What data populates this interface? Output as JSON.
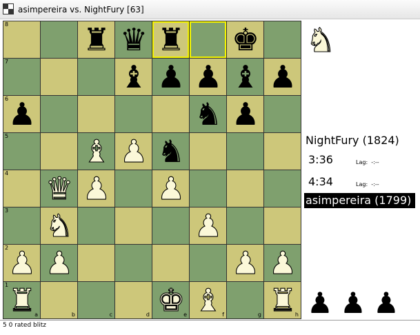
{
  "window": {
    "title": "asimpereira vs. NightFury [63]",
    "icon": "freechess-app-icon"
  },
  "colors": {
    "light_square": "#cdc77a",
    "dark_square": "#7fa06e",
    "highlight": "#f4f400",
    "white_piece": "#fbf8d8",
    "black_piece": "#000000"
  },
  "board": {
    "ranks": [
      "8",
      "7",
      "6",
      "5",
      "4",
      "3",
      "2",
      "1"
    ],
    "files": [
      "a",
      "b",
      "c",
      "d",
      "e",
      "f",
      "g",
      "h"
    ],
    "highlighted_squares": [
      "e8",
      "f8"
    ],
    "pieces": [
      {
        "square": "c8",
        "color": "b",
        "type": "rook",
        "glyph": "♜"
      },
      {
        "square": "d8",
        "color": "b",
        "type": "queen",
        "glyph": "♛"
      },
      {
        "square": "e8",
        "color": "b",
        "type": "rook",
        "glyph": "♜"
      },
      {
        "square": "g8",
        "color": "b",
        "type": "king",
        "glyph": "♚"
      },
      {
        "square": "d7",
        "color": "b",
        "type": "bishop",
        "glyph": "♝"
      },
      {
        "square": "e7",
        "color": "b",
        "type": "pawn",
        "glyph": "♟"
      },
      {
        "square": "f7",
        "color": "b",
        "type": "pawn",
        "glyph": "♟"
      },
      {
        "square": "g7",
        "color": "b",
        "type": "bishop",
        "glyph": "♝"
      },
      {
        "square": "h7",
        "color": "b",
        "type": "pawn",
        "glyph": "♟"
      },
      {
        "square": "a6",
        "color": "b",
        "type": "pawn",
        "glyph": "♟"
      },
      {
        "square": "f6",
        "color": "b",
        "type": "knight",
        "glyph": "♞"
      },
      {
        "square": "g6",
        "color": "b",
        "type": "pawn",
        "glyph": "♟"
      },
      {
        "square": "c5",
        "color": "w",
        "type": "bishop",
        "glyph": "♝"
      },
      {
        "square": "d5",
        "color": "w",
        "type": "pawn",
        "glyph": "♟"
      },
      {
        "square": "e5",
        "color": "b",
        "type": "knight",
        "glyph": "♞"
      },
      {
        "square": "b4",
        "color": "w",
        "type": "queen",
        "glyph": "♛"
      },
      {
        "square": "c4",
        "color": "w",
        "type": "pawn",
        "glyph": "♟"
      },
      {
        "square": "e4",
        "color": "w",
        "type": "pawn",
        "glyph": "♟"
      },
      {
        "square": "b3",
        "color": "w",
        "type": "knight",
        "glyph": "♞"
      },
      {
        "square": "f3",
        "color": "w",
        "type": "pawn",
        "glyph": "♟"
      },
      {
        "square": "a2",
        "color": "w",
        "type": "pawn",
        "glyph": "♟"
      },
      {
        "square": "b2",
        "color": "w",
        "type": "pawn",
        "glyph": "♟"
      },
      {
        "square": "g2",
        "color": "w",
        "type": "pawn",
        "glyph": "♟"
      },
      {
        "square": "h2",
        "color": "w",
        "type": "pawn",
        "glyph": "♟"
      },
      {
        "square": "a1",
        "color": "w",
        "type": "rook",
        "glyph": "♜"
      },
      {
        "square": "e1",
        "color": "w",
        "type": "king",
        "glyph": "♚"
      },
      {
        "square": "f1",
        "color": "w",
        "type": "bishop",
        "glyph": "♝"
      },
      {
        "square": "h1",
        "color": "w",
        "type": "rook",
        "glyph": "♜"
      }
    ]
  },
  "promotion_piece": {
    "type": "knight",
    "color": "w",
    "glyph": "♞"
  },
  "players": {
    "top": {
      "name": "NightFury (1824)",
      "clock": "3:36",
      "lag_label": "Lag:",
      "lag_value": "-:--"
    },
    "bottom": {
      "name": "asimpereira (1799)",
      "clock": "4:34",
      "lag_label": "Lag:",
      "lag_value": "-:--"
    }
  },
  "captured": [
    {
      "type": "pawn",
      "color": "b",
      "glyph": "♟"
    },
    {
      "type": "pawn",
      "color": "b",
      "glyph": "♟"
    },
    {
      "type": "pawn",
      "color": "b",
      "glyph": "♟"
    }
  ],
  "status": {
    "game_type": "5 0 rated blitz"
  }
}
